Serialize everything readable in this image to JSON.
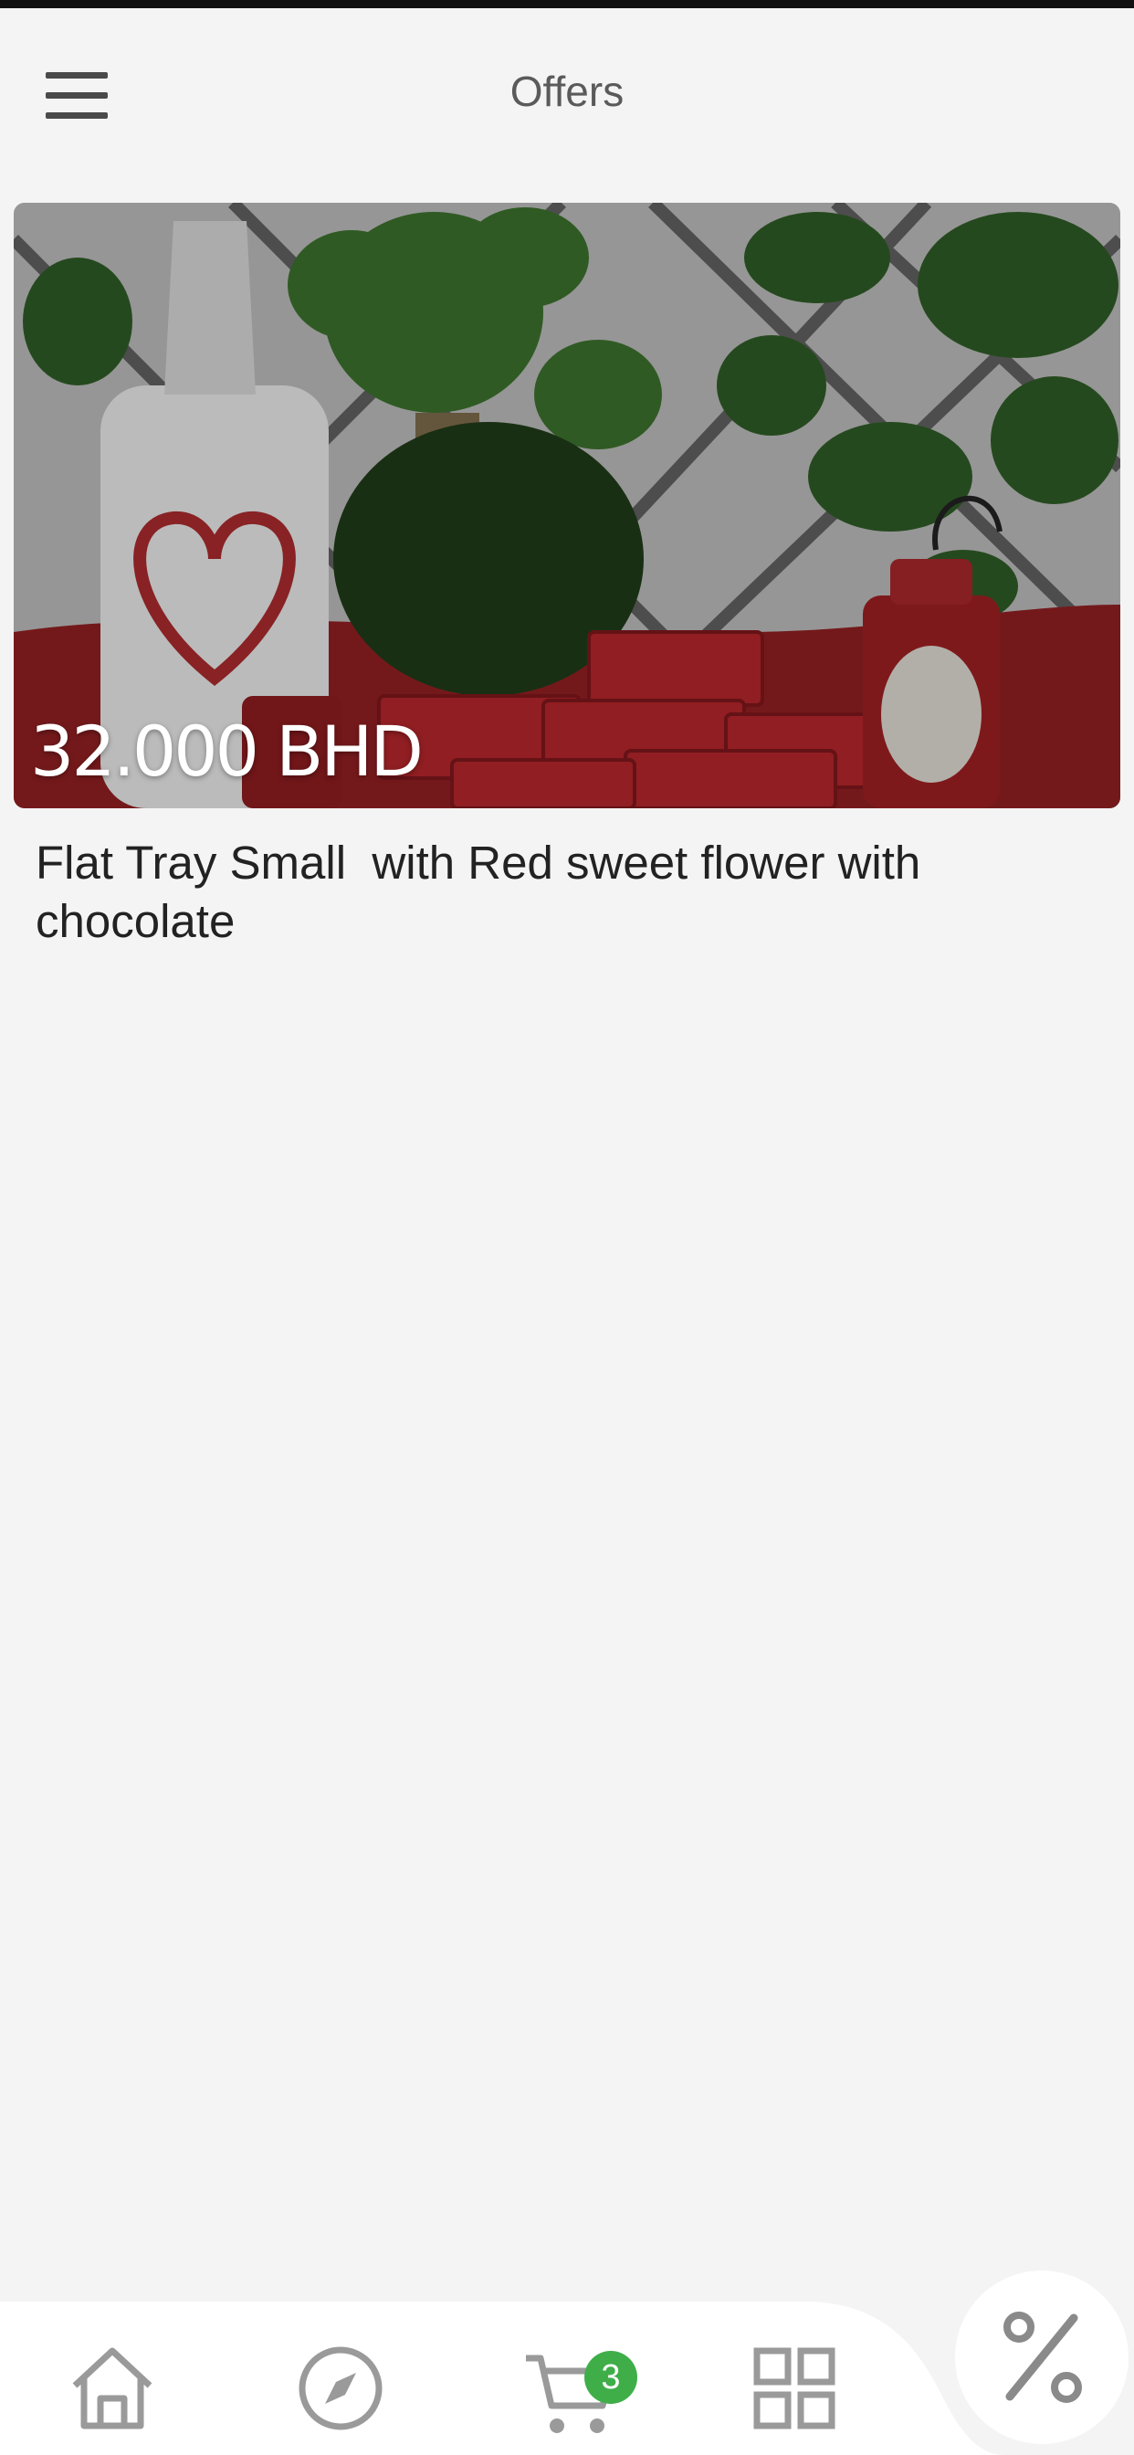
{
  "header": {
    "title": "Offers",
    "menu_icon": "hamburger-menu-icon"
  },
  "offers": [
    {
      "price": "32.000 BHD",
      "name": "Flat Tray Small  with Red sweet flower with chocolate"
    }
  ],
  "bottom_nav": {
    "items": [
      {
        "icon": "home-icon"
      },
      {
        "icon": "compass-icon"
      },
      {
        "icon": "cart-icon",
        "badge": "3"
      },
      {
        "icon": "grid-icon"
      }
    ],
    "fab_icon": "percent-icon"
  },
  "colors": {
    "background": "#f4f4f4",
    "badge": "#3fae49",
    "icon_gray": "#9a9a9a"
  }
}
